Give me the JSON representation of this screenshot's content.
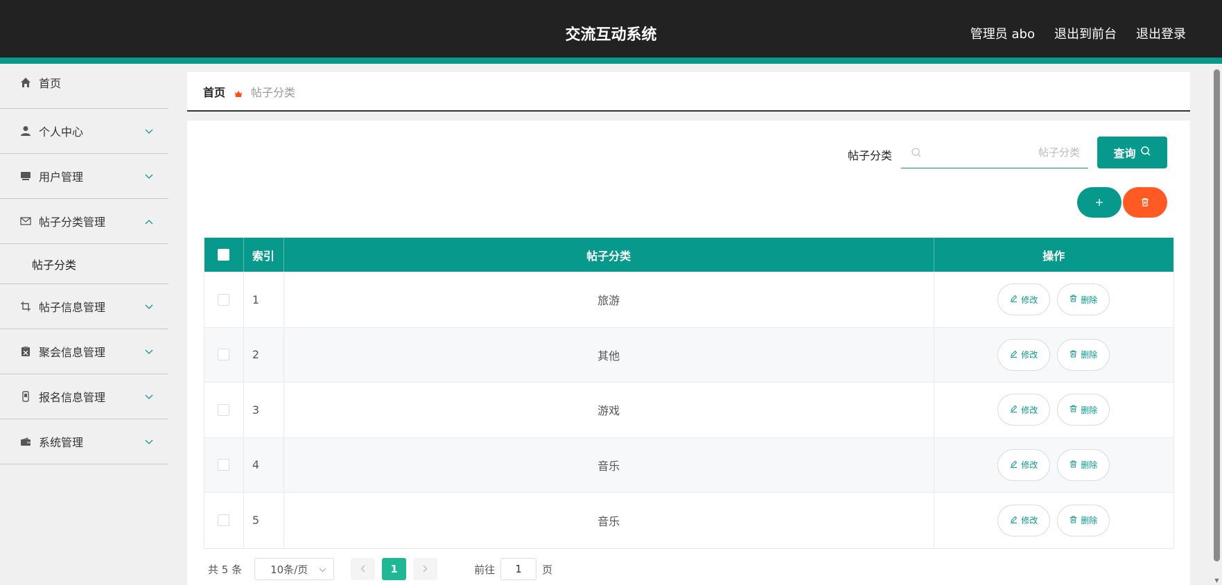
{
  "header": {
    "title": "交流互动系统",
    "admin_label": "管理员 abo",
    "exit_front": "退出到前台",
    "logout": "退出登录"
  },
  "sidebar": {
    "items": [
      {
        "label": "首页",
        "icon": "home-icon"
      },
      {
        "label": "个人中心",
        "icon": "user-icon"
      },
      {
        "label": "用户管理",
        "icon": "monitor-icon"
      },
      {
        "label": "帖子分类管理",
        "icon": "mail-icon",
        "expanded": true,
        "sub": [
          "帖子分类"
        ]
      },
      {
        "label": "帖子信息管理",
        "icon": "crop-icon"
      },
      {
        "label": "聚会信息管理",
        "icon": "clipboard-icon"
      },
      {
        "label": "报名信息管理",
        "icon": "phone-icon"
      },
      {
        "label": "系统管理",
        "icon": "wallet-icon"
      }
    ]
  },
  "breadcrumb": {
    "home": "首页",
    "current": "帖子分类"
  },
  "search": {
    "label": "帖子分类",
    "placeholder": "帖子分类",
    "button_label": "查询"
  },
  "table": {
    "headers": [
      "索引",
      "帖子分类",
      "操作"
    ],
    "rows": [
      {
        "index": "1",
        "category": "旅游"
      },
      {
        "index": "2",
        "category": "其他"
      },
      {
        "index": "3",
        "category": "游戏"
      },
      {
        "index": "4",
        "category": "音乐"
      },
      {
        "index": "5",
        "category": "音乐"
      }
    ],
    "edit_label": "修改",
    "delete_label": "删除"
  },
  "pagination": {
    "total": "共 5 条",
    "page_size": "10条/页",
    "current_page": "1",
    "goto_label": "前往",
    "goto_value": "1",
    "page_unit": "页"
  },
  "colors": {
    "accent": "#07998c",
    "danger": "#ff5a24",
    "header_bg": "#222222"
  }
}
